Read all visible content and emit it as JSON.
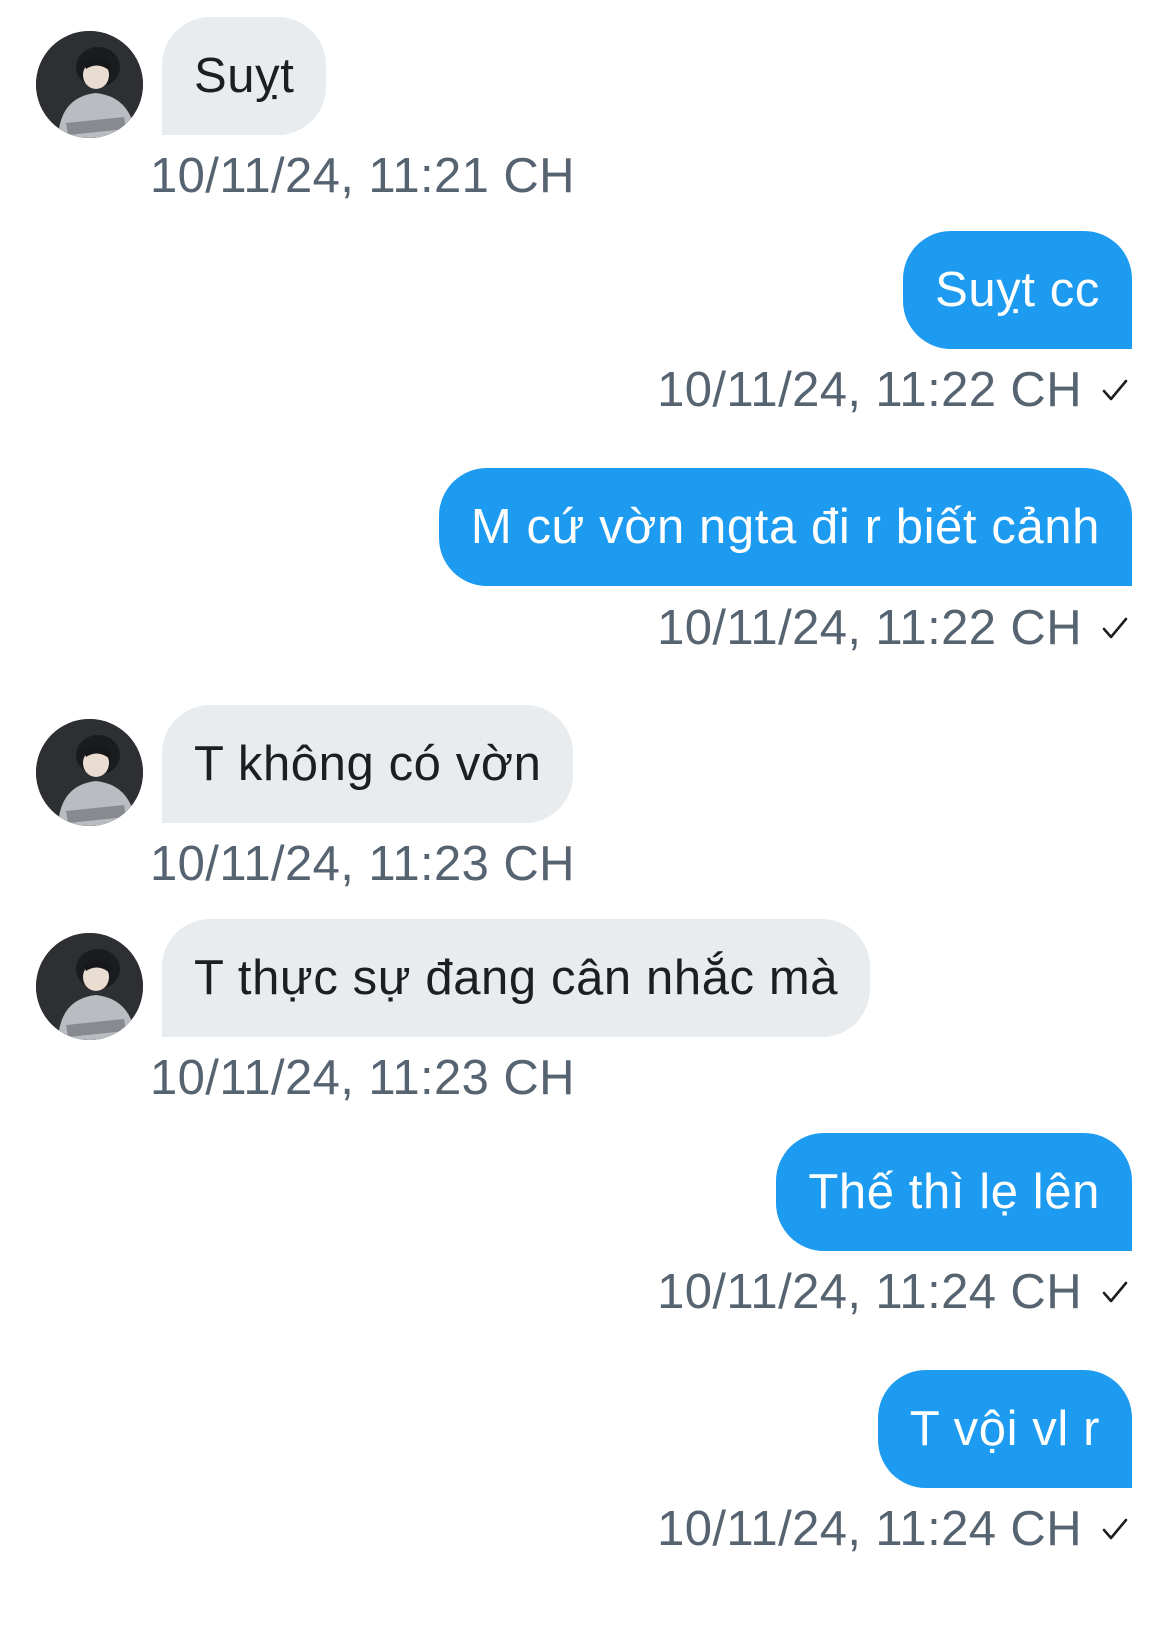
{
  "conversation": {
    "messages": [
      {
        "direction": "incoming",
        "text": "Suỵt",
        "time": "10/11/24, 11:21 CH"
      },
      {
        "direction": "outgoing",
        "text": "Suỵt cc",
        "time": "10/11/24, 11:22 CH"
      },
      {
        "direction": "outgoing",
        "text": "M cứ vờn ngta đi r biết cảnh",
        "time": "10/11/24, 11:22 CH"
      },
      {
        "direction": "incoming",
        "text": "T không có vờn",
        "time": "10/11/24, 11:23 CH"
      },
      {
        "direction": "incoming",
        "text": "T thực sự đang cân nhắc mà",
        "time": "10/11/24, 11:23 CH"
      },
      {
        "direction": "outgoing",
        "text": "Thế thì lẹ lên",
        "time": "10/11/24, 11:24 CH"
      },
      {
        "direction": "outgoing",
        "text": "T vội vl r",
        "time": "10/11/24, 11:24 CH"
      }
    ]
  },
  "icons": {
    "sent_indicator": "checkmark-icon",
    "avatar": "user-avatar"
  },
  "colors": {
    "outgoing_bubble": "#1d9bf0",
    "incoming_bubble": "#e8ecef",
    "timestamp": "#566370",
    "background": "#ffffff"
  }
}
